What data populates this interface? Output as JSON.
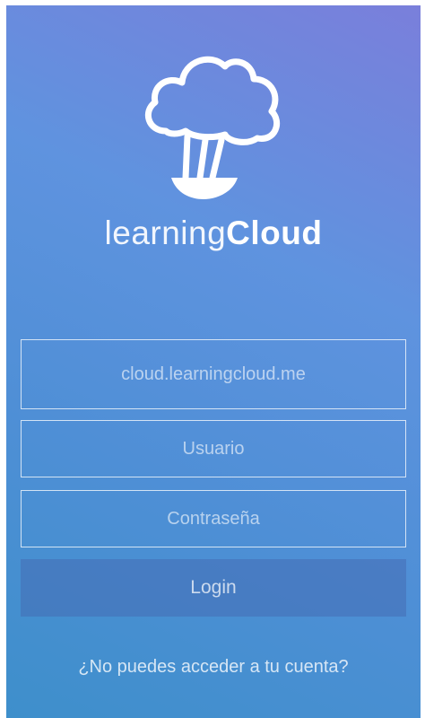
{
  "app": {
    "brand_light": "learning",
    "brand_bold": "Cloud",
    "logo_icon": "cloud-balloon-icon"
  },
  "form": {
    "server_placeholder": "cloud.learningcloud.me",
    "server_value": "",
    "user_placeholder": "Usuario",
    "user_value": "",
    "password_placeholder": "Contraseña",
    "password_value": "",
    "login_label": "Login"
  },
  "footer": {
    "forgot_link": "¿No puedes acceder a tu cuenta?"
  },
  "colors": {
    "gradient_top_right": "#7a7fdb",
    "gradient_bottom_left": "#3e8fcb",
    "login_button": "#466eb4"
  }
}
